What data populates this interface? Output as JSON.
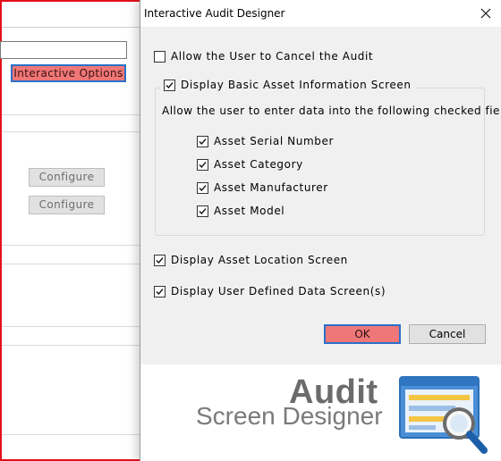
{
  "background": {
    "interactive_options_label": "Interactive Options",
    "configure_buttons": [
      "Configure",
      "Configure"
    ]
  },
  "dialog": {
    "title": "Interactive Audit Designer",
    "allow_cancel": {
      "label": "Allow the User to Cancel the Audit",
      "checked": false
    },
    "basic_info": {
      "label": "Display Basic Asset Information Screen",
      "checked": true
    },
    "instructions": "Allow the user to enter data into the following checked fields",
    "fields": [
      {
        "label": "Asset Serial Number",
        "checked": true
      },
      {
        "label": "Asset Category",
        "checked": true
      },
      {
        "label": "Asset Manufacturer",
        "checked": true
      },
      {
        "label": "Asset Model",
        "checked": true
      }
    ],
    "location_screen": {
      "label": "Display Asset Location Screen",
      "checked": true
    },
    "user_defined": {
      "label": "Display User Defined Data Screen(s)",
      "checked": true
    },
    "ok_label": "OK",
    "cancel_label": "Cancel"
  },
  "logo": {
    "title": "Audit",
    "subtitle": "Screen Designer"
  },
  "colors": {
    "frame_red": "#e3101c",
    "highlight_button": "#f07777",
    "focus_blue": "#2b70c9"
  }
}
